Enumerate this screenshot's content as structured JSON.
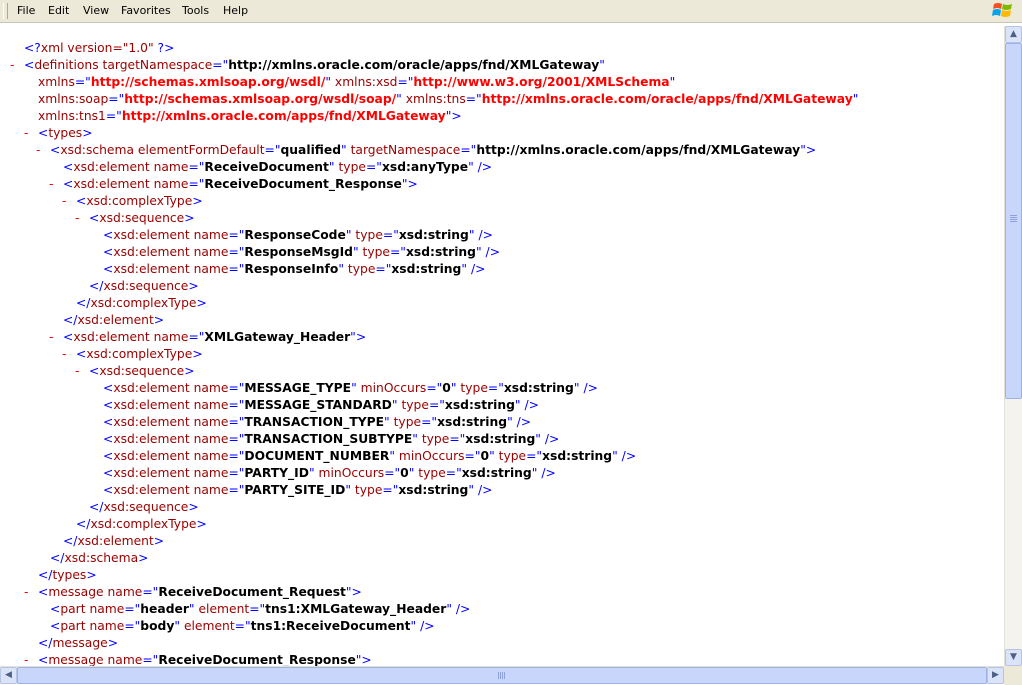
{
  "menu": [
    "File",
    "Edit",
    "View",
    "Favorites",
    "Tools",
    "Help"
  ],
  "lines": [
    {
      "t": null,
      "s": [
        [
          "b",
          "<?"
        ],
        [
          "m",
          "xml version=\"1.0\" "
        ],
        [
          "b",
          "?>"
        ]
      ]
    },
    {
      "t": "-",
      "s": [
        [
          "b",
          "<"
        ],
        [
          "m",
          "definitions"
        ],
        [
          "m",
          " targetNamespace"
        ],
        [
          "b",
          "=\""
        ],
        [
          "v",
          "http://xmlns.oracle.com/oracle/apps/fnd/XMLGateway"
        ],
        [
          "b",
          "\""
        ]
      ]
    },
    {
      "t": null,
      "s": [
        [
          "m",
          "xmlns"
        ],
        [
          "b",
          "=\""
        ],
        [
          "nsv",
          "http://schemas.xmlsoap.org/wsdl/"
        ],
        [
          "b",
          "\""
        ],
        [
          "m",
          " xmlns:xsd"
        ],
        [
          "b",
          "=\""
        ],
        [
          "nsv",
          "http://www.w3.org/2001/XMLSchema"
        ],
        [
          "b",
          "\""
        ]
      ]
    },
    {
      "t": null,
      "s": [
        [
          "m",
          "xmlns:soap"
        ],
        [
          "b",
          "=\""
        ],
        [
          "nsv",
          "http://schemas.xmlsoap.org/wsdl/soap/"
        ],
        [
          "b",
          "\""
        ],
        [
          "m",
          " xmlns:tns"
        ],
        [
          "b",
          "=\""
        ],
        [
          "nsv",
          "http://xmlns.oracle.com/oracle/apps/fnd/XMLGateway"
        ],
        [
          "b",
          "\""
        ]
      ]
    },
    {
      "t": null,
      "s": [
        [
          "m",
          "xmlns:tns1"
        ],
        [
          "b",
          "=\""
        ],
        [
          "nsv",
          "http://xmlns.oracle.com/apps/fnd/XMLGateway"
        ],
        [
          "b",
          "\">"
        ]
      ]
    },
    {
      "t": "-",
      "s": [
        [
          "b",
          "<"
        ],
        [
          "m",
          "types"
        ],
        [
          "b",
          ">"
        ]
      ]
    },
    {
      "t": "-",
      "s": [
        [
          "b",
          "<"
        ],
        [
          "m",
          "xsd:schema"
        ],
        [
          "m",
          " elementFormDefault"
        ],
        [
          "b",
          "=\""
        ],
        [
          "v",
          "qualified"
        ],
        [
          "b",
          "\""
        ],
        [
          "m",
          " targetNamespace"
        ],
        [
          "b",
          "=\""
        ],
        [
          "v",
          "http://xmlns.oracle.com/apps/fnd/XMLGateway"
        ],
        [
          "b",
          "\">"
        ]
      ]
    },
    {
      "t": null,
      "s": [
        [
          "b",
          "<"
        ],
        [
          "m",
          "xsd:element"
        ],
        [
          "m",
          " name"
        ],
        [
          "b",
          "=\""
        ],
        [
          "v",
          "ReceiveDocument"
        ],
        [
          "b",
          "\""
        ],
        [
          "m",
          " type"
        ],
        [
          "b",
          "=\""
        ],
        [
          "v",
          "xsd:anyType"
        ],
        [
          "b",
          "\" />"
        ]
      ]
    },
    {
      "t": "-",
      "s": [
        [
          "b",
          "<"
        ],
        [
          "m",
          "xsd:element"
        ],
        [
          "m",
          " name"
        ],
        [
          "b",
          "=\""
        ],
        [
          "v",
          "ReceiveDocument_Response"
        ],
        [
          "b",
          "\">"
        ]
      ]
    },
    {
      "t": "-",
      "s": [
        [
          "b",
          "<"
        ],
        [
          "m",
          "xsd:complexType"
        ],
        [
          "b",
          ">"
        ]
      ]
    },
    {
      "t": "-",
      "s": [
        [
          "b",
          "<"
        ],
        [
          "m",
          "xsd:sequence"
        ],
        [
          "b",
          ">"
        ]
      ]
    },
    {
      "t": null,
      "s": [
        [
          "b",
          "<"
        ],
        [
          "m",
          "xsd:element"
        ],
        [
          "m",
          " name"
        ],
        [
          "b",
          "=\""
        ],
        [
          "v",
          "ResponseCode"
        ],
        [
          "b",
          "\""
        ],
        [
          "m",
          " type"
        ],
        [
          "b",
          "=\""
        ],
        [
          "v",
          "xsd:string"
        ],
        [
          "b",
          "\" />"
        ]
      ]
    },
    {
      "t": null,
      "s": [
        [
          "b",
          "<"
        ],
        [
          "m",
          "xsd:element"
        ],
        [
          "m",
          " name"
        ],
        [
          "b",
          "=\""
        ],
        [
          "v",
          "ResponseMsgId"
        ],
        [
          "b",
          "\""
        ],
        [
          "m",
          " type"
        ],
        [
          "b",
          "=\""
        ],
        [
          "v",
          "xsd:string"
        ],
        [
          "b",
          "\" />"
        ]
      ]
    },
    {
      "t": null,
      "s": [
        [
          "b",
          "<"
        ],
        [
          "m",
          "xsd:element"
        ],
        [
          "m",
          " name"
        ],
        [
          "b",
          "=\""
        ],
        [
          "v",
          "ResponseInfo"
        ],
        [
          "b",
          "\""
        ],
        [
          "m",
          " type"
        ],
        [
          "b",
          "=\""
        ],
        [
          "v",
          "xsd:string"
        ],
        [
          "b",
          "\" />"
        ]
      ]
    },
    {
      "t": null,
      "s": [
        [
          "b",
          "</"
        ],
        [
          "m",
          "xsd:sequence"
        ],
        [
          "b",
          ">"
        ]
      ]
    },
    {
      "t": null,
      "s": [
        [
          "b",
          "</"
        ],
        [
          "m",
          "xsd:complexType"
        ],
        [
          "b",
          ">"
        ]
      ]
    },
    {
      "t": null,
      "s": [
        [
          "b",
          "</"
        ],
        [
          "m",
          "xsd:element"
        ],
        [
          "b",
          ">"
        ]
      ]
    },
    {
      "t": "-",
      "s": [
        [
          "b",
          "<"
        ],
        [
          "m",
          "xsd:element"
        ],
        [
          "m",
          " name"
        ],
        [
          "b",
          "=\""
        ],
        [
          "v",
          "XMLGateway_Header"
        ],
        [
          "b",
          "\">"
        ]
      ]
    },
    {
      "t": "-",
      "s": [
        [
          "b",
          "<"
        ],
        [
          "m",
          "xsd:complexType"
        ],
        [
          "b",
          ">"
        ]
      ]
    },
    {
      "t": "-",
      "s": [
        [
          "b",
          "<"
        ],
        [
          "m",
          "xsd:sequence"
        ],
        [
          "b",
          ">"
        ]
      ]
    },
    {
      "t": null,
      "s": [
        [
          "b",
          "<"
        ],
        [
          "m",
          "xsd:element"
        ],
        [
          "m",
          " name"
        ],
        [
          "b",
          "=\""
        ],
        [
          "v",
          "MESSAGE_TYPE"
        ],
        [
          "b",
          "\""
        ],
        [
          "m",
          " minOccurs"
        ],
        [
          "b",
          "=\""
        ],
        [
          "v",
          "0"
        ],
        [
          "b",
          "\""
        ],
        [
          "m",
          " type"
        ],
        [
          "b",
          "=\""
        ],
        [
          "v",
          "xsd:string"
        ],
        [
          "b",
          "\" />"
        ]
      ]
    },
    {
      "t": null,
      "s": [
        [
          "b",
          "<"
        ],
        [
          "m",
          "xsd:element"
        ],
        [
          "m",
          " name"
        ],
        [
          "b",
          "=\""
        ],
        [
          "v",
          "MESSAGE_STANDARD"
        ],
        [
          "b",
          "\""
        ],
        [
          "m",
          " type"
        ],
        [
          "b",
          "=\""
        ],
        [
          "v",
          "xsd:string"
        ],
        [
          "b",
          "\" />"
        ]
      ]
    },
    {
      "t": null,
      "s": [
        [
          "b",
          "<"
        ],
        [
          "m",
          "xsd:element"
        ],
        [
          "m",
          " name"
        ],
        [
          "b",
          "=\""
        ],
        [
          "v",
          "TRANSACTION_TYPE"
        ],
        [
          "b",
          "\""
        ],
        [
          "m",
          " type"
        ],
        [
          "b",
          "=\""
        ],
        [
          "v",
          "xsd:string"
        ],
        [
          "b",
          "\" />"
        ]
      ]
    },
    {
      "t": null,
      "s": [
        [
          "b",
          "<"
        ],
        [
          "m",
          "xsd:element"
        ],
        [
          "m",
          " name"
        ],
        [
          "b",
          "=\""
        ],
        [
          "v",
          "TRANSACTION_SUBTYPE"
        ],
        [
          "b",
          "\""
        ],
        [
          "m",
          " type"
        ],
        [
          "b",
          "=\""
        ],
        [
          "v",
          "xsd:string"
        ],
        [
          "b",
          "\" />"
        ]
      ]
    },
    {
      "t": null,
      "s": [
        [
          "b",
          "<"
        ],
        [
          "m",
          "xsd:element"
        ],
        [
          "m",
          " name"
        ],
        [
          "b",
          "=\""
        ],
        [
          "v",
          "DOCUMENT_NUMBER"
        ],
        [
          "b",
          "\""
        ],
        [
          "m",
          " minOccurs"
        ],
        [
          "b",
          "=\""
        ],
        [
          "v",
          "0"
        ],
        [
          "b",
          "\""
        ],
        [
          "m",
          " type"
        ],
        [
          "b",
          "=\""
        ],
        [
          "v",
          "xsd:string"
        ],
        [
          "b",
          "\" />"
        ]
      ]
    },
    {
      "t": null,
      "s": [
        [
          "b",
          "<"
        ],
        [
          "m",
          "xsd:element"
        ],
        [
          "m",
          " name"
        ],
        [
          "b",
          "=\""
        ],
        [
          "v",
          "PARTY_ID"
        ],
        [
          "b",
          "\""
        ],
        [
          "m",
          " minOccurs"
        ],
        [
          "b",
          "=\""
        ],
        [
          "v",
          "0"
        ],
        [
          "b",
          "\""
        ],
        [
          "m",
          " type"
        ],
        [
          "b",
          "=\""
        ],
        [
          "v",
          "xsd:string"
        ],
        [
          "b",
          "\" />"
        ]
      ]
    },
    {
      "t": null,
      "s": [
        [
          "b",
          "<"
        ],
        [
          "m",
          "xsd:element"
        ],
        [
          "m",
          " name"
        ],
        [
          "b",
          "=\""
        ],
        [
          "v",
          "PARTY_SITE_ID"
        ],
        [
          "b",
          "\""
        ],
        [
          "m",
          " type"
        ],
        [
          "b",
          "=\""
        ],
        [
          "v",
          "xsd:string"
        ],
        [
          "b",
          "\" />"
        ]
      ]
    },
    {
      "t": null,
      "s": [
        [
          "b",
          "</"
        ],
        [
          "m",
          "xsd:sequence"
        ],
        [
          "b",
          ">"
        ]
      ]
    },
    {
      "t": null,
      "s": [
        [
          "b",
          "</"
        ],
        [
          "m",
          "xsd:complexType"
        ],
        [
          "b",
          ">"
        ]
      ]
    },
    {
      "t": null,
      "s": [
        [
          "b",
          "</"
        ],
        [
          "m",
          "xsd:element"
        ],
        [
          "b",
          ">"
        ]
      ]
    },
    {
      "t": null,
      "s": [
        [
          "b",
          "</"
        ],
        [
          "m",
          "xsd:schema"
        ],
        [
          "b",
          ">"
        ]
      ]
    },
    {
      "t": null,
      "s": [
        [
          "b",
          "</"
        ],
        [
          "m",
          "types"
        ],
        [
          "b",
          ">"
        ]
      ]
    },
    {
      "t": "-",
      "s": [
        [
          "b",
          "<"
        ],
        [
          "m",
          "message"
        ],
        [
          "m",
          " name"
        ],
        [
          "b",
          "=\""
        ],
        [
          "v",
          "ReceiveDocument_Request"
        ],
        [
          "b",
          "\">"
        ]
      ]
    },
    {
      "t": null,
      "s": [
        [
          "b",
          "<"
        ],
        [
          "m",
          "part"
        ],
        [
          "m",
          " name"
        ],
        [
          "b",
          "=\""
        ],
        [
          "v",
          "header"
        ],
        [
          "b",
          "\""
        ],
        [
          "m",
          " element"
        ],
        [
          "b",
          "=\""
        ],
        [
          "v",
          "tns1:XMLGateway_Header"
        ],
        [
          "b",
          "\" />"
        ]
      ]
    },
    {
      "t": null,
      "s": [
        [
          "b",
          "<"
        ],
        [
          "m",
          "part"
        ],
        [
          "m",
          " name"
        ],
        [
          "b",
          "=\""
        ],
        [
          "v",
          "body"
        ],
        [
          "b",
          "\""
        ],
        [
          "m",
          " element"
        ],
        [
          "b",
          "=\""
        ],
        [
          "v",
          "tns1:ReceiveDocument"
        ],
        [
          "b",
          "\" />"
        ]
      ]
    },
    {
      "t": null,
      "s": [
        [
          "b",
          "</"
        ],
        [
          "m",
          "message"
        ],
        [
          "b",
          ">"
        ]
      ]
    },
    {
      "t": "-",
      "s": [
        [
          "b",
          "<"
        ],
        [
          "m",
          "message"
        ],
        [
          "m",
          " name"
        ],
        [
          "b",
          "=\""
        ],
        [
          "v",
          "ReceiveDocument_Response"
        ],
        [
          "b",
          "\">"
        ]
      ]
    }
  ]
}
